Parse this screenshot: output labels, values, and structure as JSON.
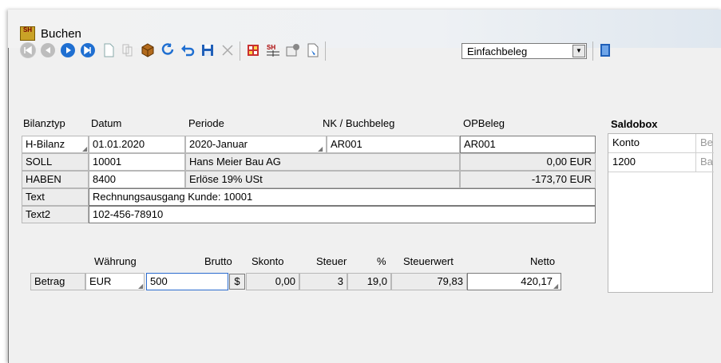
{
  "window": {
    "title": "Buchen",
    "app_icon_text": "SH"
  },
  "toolbar": {
    "icons": [
      "first-record-icon",
      "previous-record-icon",
      "next-record-icon",
      "last-record-icon",
      "new-document-icon",
      "copy-document-icon",
      "package-icon",
      "refresh-icon",
      "undo-icon",
      "save-icon",
      "delete-icon",
      "calculator-icon",
      "sh-icon",
      "properties-icon",
      "export-icon",
      "exit-icon"
    ],
    "doc_type": "Einfachbeleg"
  },
  "headers": {
    "bilanztyp": "Bilanztyp",
    "datum": "Datum",
    "periode": "Periode",
    "nk_buchbeleg": "NK / Buchbeleg",
    "opbeleg": "OPBeleg"
  },
  "row1": {
    "bilanztyp": "H-Bilanz",
    "datum": "01.01.2020",
    "periode": "2020-Januar",
    "nk": "AR001",
    "opbeleg": "AR001"
  },
  "soll": {
    "label": "SOLL",
    "konto": "10001",
    "name": "Hans Meier Bau AG",
    "saldo": "0,00 EUR"
  },
  "haben": {
    "label": "HABEN",
    "konto": "8400",
    "name": "Erlöse 19% USt",
    "saldo": "-173,70 EUR"
  },
  "text": {
    "label": "Text",
    "value": "Rechnungsausgang Kunde: 10001"
  },
  "text2": {
    "label": "Text2",
    "value": "102-456-78910"
  },
  "betrag_headers": {
    "waehrung": "Währung",
    "brutto": "Brutto",
    "skonto": "Skonto",
    "steuer": "Steuer",
    "prozent": "%",
    "steuerwert": "Steuerwert",
    "netto": "Netto"
  },
  "betrag": {
    "label": "Betrag",
    "waehrung": "EUR",
    "brutto": "500",
    "currency_symbol": "$",
    "skonto": "0,00",
    "steuer": "3",
    "prozent": "19,0",
    "steuerwert": "79,83",
    "netto": "420,17"
  },
  "saldobox": {
    "title": "Saldobox",
    "col_konto": "Konto",
    "col_partial": "Be",
    "row_konto": "1200",
    "row_partial": "Ba"
  }
}
